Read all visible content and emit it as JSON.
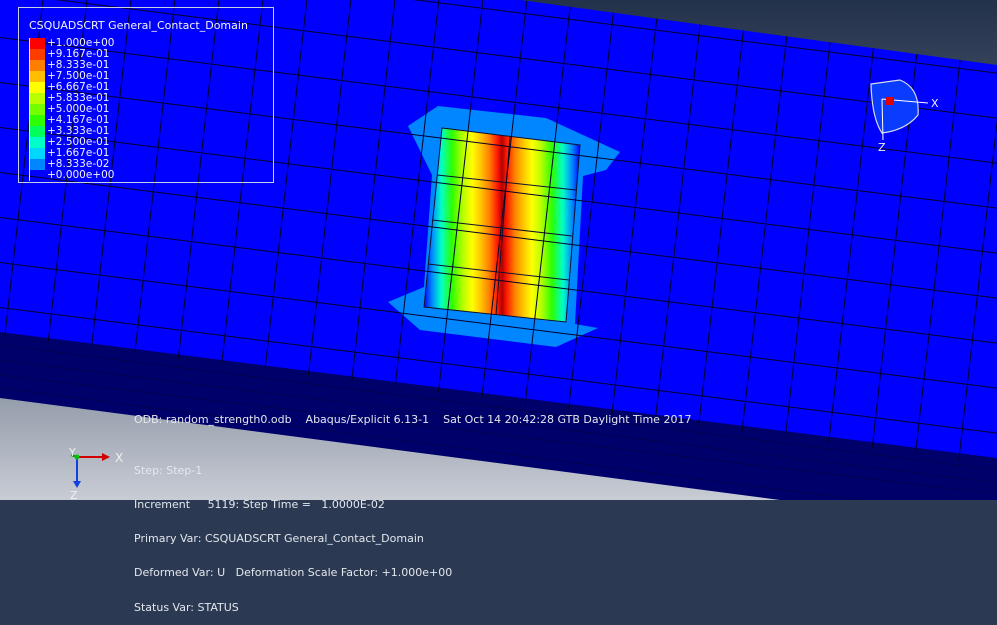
{
  "legend": {
    "title": "CSQUADSCRT General_Contact_Domain",
    "entries": [
      {
        "label": "+1.000e+00",
        "color": "#ff0000"
      },
      {
        "label": "+9.167e-01",
        "color": "#ff3c00"
      },
      {
        "label": "+8.333e-01",
        "color": "#ff7d00"
      },
      {
        "label": "+7.500e-01",
        "color": "#ffbe00"
      },
      {
        "label": "+6.667e-01",
        "color": "#ffff00"
      },
      {
        "label": "+5.833e-01",
        "color": "#b9ff00"
      },
      {
        "label": "+5.000e-01",
        "color": "#73ff00"
      },
      {
        "label": "+4.167e-01",
        "color": "#2dff00"
      },
      {
        "label": "+3.333e-01",
        "color": "#00ff5a"
      },
      {
        "label": "+2.500e-01",
        "color": "#00ffc8"
      },
      {
        "label": "+1.667e-01",
        "color": "#00d7ff"
      },
      {
        "label": "+8.333e-02",
        "color": "#0087ff"
      },
      {
        "label": "+0.000e+00",
        "color": "#0000ff"
      }
    ]
  },
  "triad_top": {
    "x_label": "X",
    "z_label": "Z"
  },
  "triad_bottom": {
    "y_label": "Y",
    "x_label": "X",
    "z_label": "Z"
  },
  "info": {
    "odb": "ODB: random_strength0.odb    Abaqus/Explicit 6.13-1    Sat Oct 14 20:42:28 GTB Daylight Time 2017",
    "step": "Step: Step-1",
    "increment": "Increment     5119: Step Time =   1.0000E-02",
    "primary_var": "Primary Var: CSQUADSCRT General_Contact_Domain",
    "deformed_var": "Deformed Var: U   Deformation Scale Factor: +1.000e+00",
    "status_var": "Status Var: STATUS"
  }
}
